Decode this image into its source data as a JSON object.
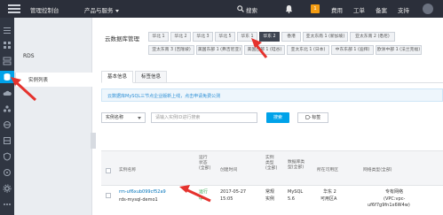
{
  "topbar": {
    "console": "管理控制台",
    "products": "产品与服务",
    "search": "搜索",
    "badge_count": "1",
    "billing": "费用",
    "ticket": "工单",
    "record": "备案",
    "support": "支持"
  },
  "subnav": {
    "title": "RDS",
    "item": "实例列表"
  },
  "regions": {
    "label": "云数据库管理",
    "items": [
      "华北 1",
      "华北 2",
      "华北 3",
      "华北 5",
      "华东 1",
      "华东 2",
      "香港",
      "亚太东南 1 (新加坡)",
      "亚太东南 2 (悉尼)",
      "亚太东南 3 (吉隆坡)",
      "美国东部 1 (弗吉尼亚)",
      "美国西部 1 (硅谷)",
      "亚太东北 1 (日本)",
      "中东东部 1 (迪拜)",
      "欧洲中部 1 (法兰克福)"
    ],
    "active_index": 5
  },
  "tabs": [
    "基本信息",
    "标签信息"
  ],
  "notice": "云数据库MySQL三节点企业版新上线，点击申请免费公测",
  "search": {
    "select_value": "实例名称",
    "placeholder": "请输入实例ID进行搜索",
    "button": "搜索",
    "tag_button": "标签"
  },
  "table": {
    "headers": {
      "name": "实例名称",
      "status": "运行状态(全部)",
      "created": "创建时间",
      "type": "实例类型(全部)",
      "db": "数据库类型(全部)",
      "zone": "所在可用区",
      "network": "网络类型(全部)"
    },
    "row": {
      "id": "rm-uf6xub099cf52a9",
      "name": "rds-mysql-demo1",
      "status_line1": "运行",
      "status_line2": "中",
      "created_line1": "2017-05-27",
      "created_line2": "15:05",
      "type_line1": "常规",
      "type_line2": "实例",
      "db_line1": "MySQL",
      "db_line2": "5.6",
      "zone_line1": "华东 2",
      "zone_line2": "可用区A",
      "network_line1": "专有网络",
      "network_line2": "(VPC:vpc-",
      "network_line3": "uf6f7g9fn1x6W4w)"
    }
  },
  "colors": {
    "topbar": "#2b2f3a",
    "accent": "#00a2e9",
    "annotation": "#e5322d"
  }
}
